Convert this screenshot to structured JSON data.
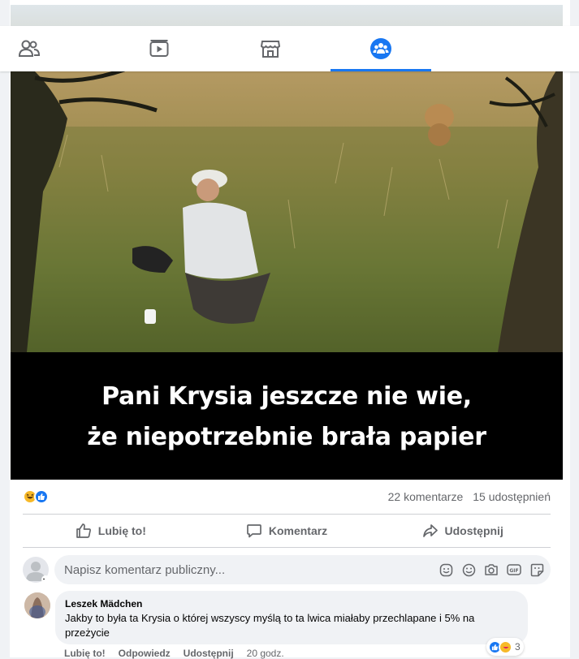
{
  "nav": {
    "tabs": [
      {
        "icon": "friends-icon",
        "active": false
      },
      {
        "icon": "watch-icon",
        "active": false
      },
      {
        "icon": "marketplace-icon",
        "active": false
      },
      {
        "icon": "groups-icon",
        "active": true
      }
    ],
    "accent": "#1877f2"
  },
  "post": {
    "image_caption_line1": "Pani Krysia jeszcze nie wie,",
    "image_caption_line2": "że niepotrzebnie brała papier",
    "reactions": [
      "haha-icon",
      "like-icon"
    ],
    "comments_count": "22 komentarze",
    "shares_count": "15 udostępnień"
  },
  "actions": {
    "like": "Lubię to!",
    "comment": "Komentarz",
    "share": "Udostępnij"
  },
  "composer": {
    "placeholder": "Napisz komentarz publiczny...",
    "icons": [
      "sticker-smile-icon",
      "emoji-icon",
      "camera-icon",
      "gif-icon",
      "sticker-icon"
    ]
  },
  "comment": {
    "author": "Leszek Mädchen",
    "text": "Jakby to była ta Krysia o której wszyscy myślą to ta lwica miałaby przechlapane i 5% na przeżycie",
    "like": "Lubię to!",
    "reply": "Odpowiedz",
    "share": "Udostępnij",
    "time": "20 godz.",
    "reaction_count": "3"
  }
}
